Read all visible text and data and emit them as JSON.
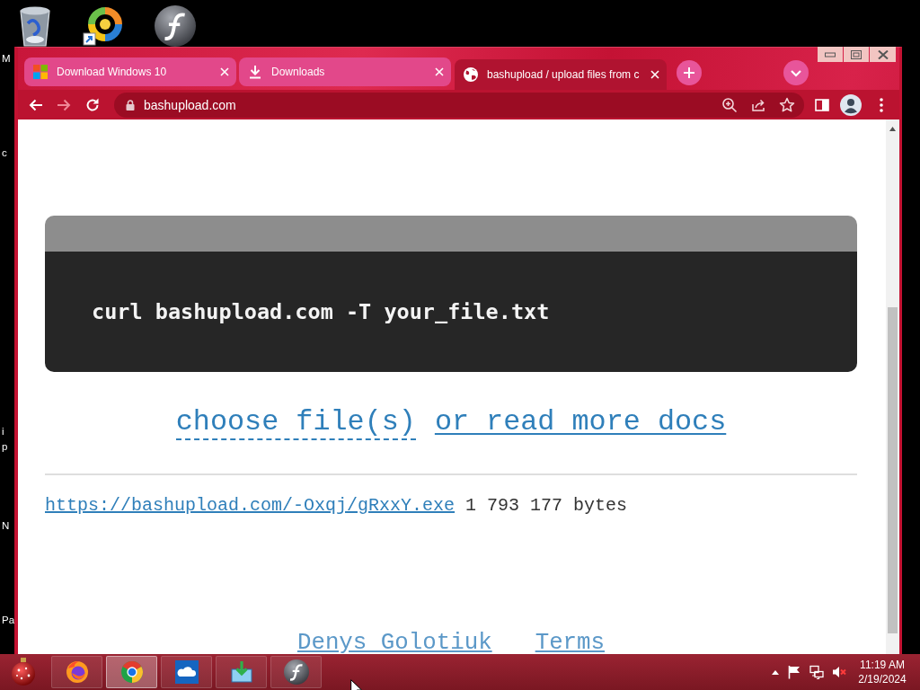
{
  "desktop": {
    "cut_labels": [
      "M",
      "c",
      "i",
      "p",
      "N",
      "Pa"
    ]
  },
  "browser": {
    "tabs": [
      {
        "kind": "logo",
        "title": "Download Windows 10",
        "selected": false
      },
      {
        "kind": "download",
        "title": "Downloads",
        "selected": false
      },
      {
        "kind": "globe",
        "title": "bashupload / upload files from c",
        "selected": true
      }
    ],
    "back_disabled": false,
    "forward_disabled": true,
    "address": "bashupload.com"
  },
  "page": {
    "command": "curl bashupload.com -T your_file.txt",
    "choose_link": "choose file(s)",
    "docs_link": "or read more docs",
    "upload": {
      "url": "https://bashupload.com/-Oxqj/gRxxY.exe",
      "size": "1 793 177 bytes"
    },
    "footer_links": [
      "Denys Golotiuk",
      "Terms"
    ]
  },
  "taskbar": {
    "apps": [
      {
        "kind": "flame",
        "selected": false
      },
      {
        "kind": "pinwheel",
        "selected": true
      },
      {
        "kind": "cloud",
        "selected": false
      },
      {
        "kind": "tray",
        "selected": false
      },
      {
        "kind": "swoosh",
        "selected": false
      }
    ],
    "volume_muted": true,
    "clock": {
      "time": "11:19 AM",
      "date": "2/19/2024"
    }
  }
}
